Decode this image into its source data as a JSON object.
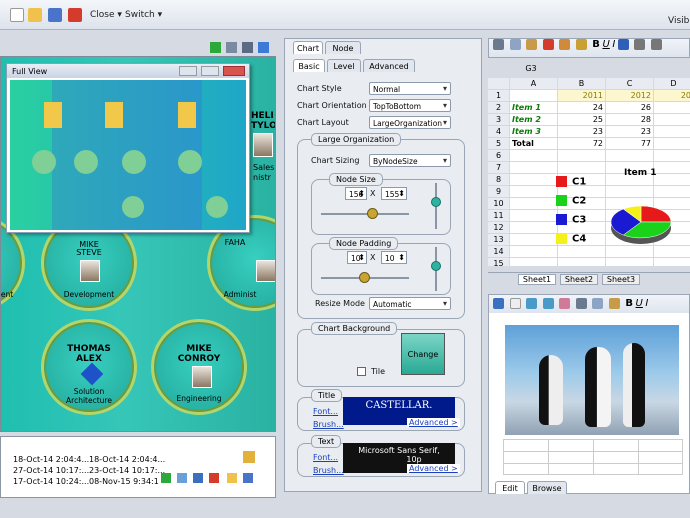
{
  "toolbar": {
    "close_label": "Close",
    "switch_label": "Switch",
    "visible_label": "Visib"
  },
  "chart": {
    "nodes": [
      {
        "name": "MIKE",
        "surname": "STEVE",
        "dept": "Development"
      },
      {
        "name": "FAHA",
        "surname": "",
        "dept": "Administ"
      },
      {
        "name": "THOMAS",
        "surname": "ALEX",
        "dept": "Solution Architecture"
      },
      {
        "name": "MIKE",
        "surname": "CONROY",
        "dept": "Engineering"
      },
      {
        "name": "HELI",
        "surname": "TYLO",
        "dept": "Sales"
      },
      {
        "name": "",
        "surname": "",
        "dept": "nistr"
      }
    ],
    "left_fragment": "ent"
  },
  "full_view": {
    "title": "Full View"
  },
  "log": {
    "col1": [
      "18-Oct-14 2:04:4...",
      "27-Oct-14 10:17:...",
      "17-Oct-14 10:24:..."
    ],
    "col2": [
      "18-Oct-14 2:04:4...",
      "23-Oct-14 10:17:...",
      "08-Nov-15 9:34:1"
    ]
  },
  "props": {
    "top_tabs": [
      "Chart",
      "Node"
    ],
    "sub_tabs": [
      "Basic",
      "Level",
      "Advanced"
    ],
    "chart_style_label": "Chart Style",
    "chart_style": "Normal",
    "chart_orientation_label": "Chart Orientation",
    "chart_orientation": "TopToBottom",
    "chart_layout_label": "Chart Layout",
    "chart_layout": "LargeOrganization",
    "large_org_title": "Large Organization",
    "chart_sizing_label": "Chart Sizing",
    "chart_sizing": "ByNodeSize",
    "node_size_title": "Node Size",
    "node_w": "156",
    "node_h": "155",
    "x": "X",
    "node_padding_title": "Node Padding",
    "pad_w": "10",
    "pad_h": "10",
    "resize_mode_label": "Resize Mode",
    "resize_mode": "Automatic",
    "chart_bg_title": "Chart Background",
    "change_label": "Change",
    "tile_label": "Tile",
    "title_group": "Title",
    "font_link": "Font...",
    "brush_link": "Brush...",
    "title_font_preview": "CASTELLAR.",
    "advanced_label": "Advanced >",
    "text_group": "Text",
    "text_font_preview": "Microsoft Sans Serif,",
    "text_font_size": "10p"
  },
  "sheet": {
    "cell_ref": "G3",
    "columns": [
      "A",
      "B",
      "C",
      "D"
    ],
    "years": [
      "2011",
      "2012",
      "20"
    ],
    "rows": [
      {
        "n": "1",
        "a": "",
        "b": "2011",
        "c": "2012",
        "d": "20"
      },
      {
        "n": "2",
        "a": "Item 1",
        "b": "24",
        "c": "26",
        "d": ""
      },
      {
        "n": "3",
        "a": "Item 2",
        "b": "25",
        "c": "28",
        "d": ""
      },
      {
        "n": "4",
        "a": "Item 3",
        "b": "23",
        "c": "23",
        "d": ""
      },
      {
        "n": "5",
        "a": "Total",
        "b": "72",
        "c": "77",
        "d": ""
      },
      {
        "n": "6"
      },
      {
        "n": "7"
      },
      {
        "n": "8"
      },
      {
        "n": "9"
      },
      {
        "n": "10"
      },
      {
        "n": "11"
      },
      {
        "n": "12"
      },
      {
        "n": "13"
      },
      {
        "n": "14"
      },
      {
        "n": "15"
      }
    ],
    "tabs": [
      "Sheet1",
      "Sheet2",
      "Sheet3"
    ]
  },
  "chart_data": {
    "type": "pie",
    "title": "Item 1",
    "categories": [
      "C1",
      "C2",
      "C3",
      "C4"
    ],
    "colors": [
      "#e61a1a",
      "#1ad21a",
      "#1a1ad2",
      "#f5f01a"
    ],
    "values": [
      25,
      35,
      30,
      10
    ]
  },
  "viewer": {
    "tabs": [
      "Edit",
      "Browse"
    ]
  }
}
